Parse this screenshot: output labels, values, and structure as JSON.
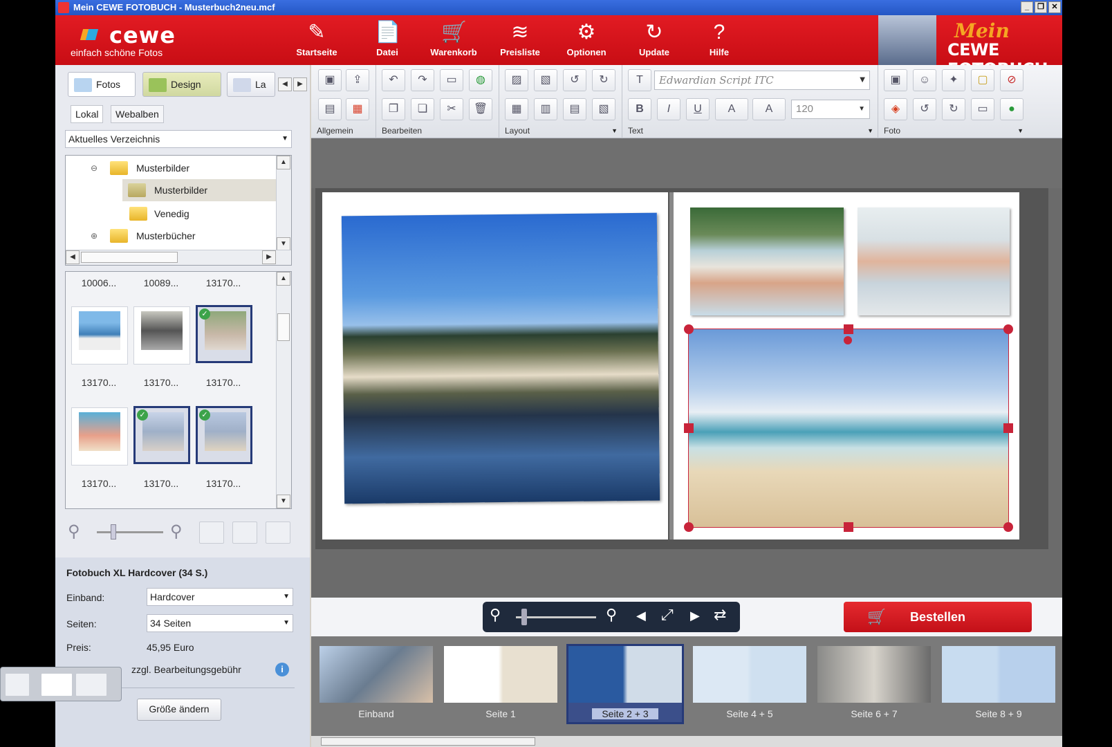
{
  "window": {
    "title": "Mein CEWE FOTOBUCH - Musterbuch2neu.mcf",
    "controls": [
      "_",
      "❐",
      "✕"
    ]
  },
  "header": {
    "logo": {
      "word": "cewe",
      "tagline": "einfach schöne Fotos"
    },
    "buttons": [
      {
        "label": "Startseite",
        "icon": "✎"
      },
      {
        "label": "Datei",
        "icon": "📄"
      },
      {
        "label": "Warenkorb",
        "icon": "🛒"
      },
      {
        "label": "Preisliste",
        "icon": "≋"
      },
      {
        "label": "Optionen",
        "icon": "⚙"
      },
      {
        "label": "Update",
        "icon": "↻"
      },
      {
        "label": "Hilfe",
        "icon": "?"
      }
    ],
    "brand": {
      "line1": "Mein",
      "line2": "CEWE FOTOBUCH"
    }
  },
  "left": {
    "tabs": [
      "Fotos",
      "Design",
      "La"
    ],
    "subtabs": [
      "Lokal",
      "Webalben"
    ],
    "directory": "Aktuelles Verzeichnis",
    "tree": [
      "Musterbilder",
      "Musterbilder",
      "Venedig",
      "Musterbücher"
    ],
    "thumb_labels_top": [
      "10006...",
      "10089...",
      "13170..."
    ],
    "thumb_labels_row1": [
      "13170...",
      "13170...",
      "13170..."
    ],
    "thumb_labels_row2": [
      "13170...",
      "13170...",
      "13170..."
    ],
    "product": {
      "title": "Fotobuch XL Hardcover (34 S.)",
      "binding_label": "Einband:",
      "binding_value": "Hardcover",
      "pages_label": "Seiten:",
      "pages_value": "34 Seiten",
      "price_label": "Preis:",
      "price_value": "45,95 Euro",
      "fee_note": "zzgl. Bearbeitungsgebühr",
      "resize_button": "Größe ändern"
    }
  },
  "ribbon": {
    "groups": [
      "Allgemein",
      "Bearbeiten",
      "Layout",
      "Text",
      "Foto"
    ],
    "font": "Edwardian Script ITC",
    "font_size": "120",
    "text_buttons": [
      "B",
      "I",
      "U",
      "A",
      "A"
    ]
  },
  "nav": {
    "order_label": "Bestellen"
  },
  "pages": [
    {
      "label": "Einband"
    },
    {
      "label": "Seite 1"
    },
    {
      "label": "Seite 2 + 3"
    },
    {
      "label": "Seite 4 + 5"
    },
    {
      "label": "Seite 6 + 7"
    },
    {
      "label": "Seite 8 + 9"
    }
  ]
}
